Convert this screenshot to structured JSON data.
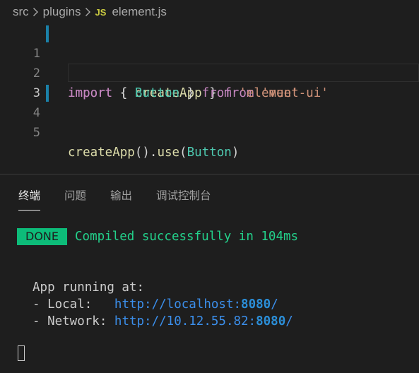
{
  "breadcrumb": {
    "folder1": "src",
    "folder2": "plugins",
    "file_icon": "JS",
    "file_name": "element.js"
  },
  "editor": {
    "lines": [
      {
        "number": "1",
        "tokens": {
          "t1": "import",
          "t2": " { ",
          "t3": "createApp",
          "t4": " } ",
          "t5": "from",
          "t6": " ",
          "t7": "'vue'"
        }
      },
      {
        "number": "2",
        "tokens": {
          "t1": "import",
          "t2": " { ",
          "t3": "Button",
          "t4": " } ",
          "t5": "from",
          "t6": " ",
          "t7": "'element-ui'"
        }
      },
      {
        "number": "3"
      },
      {
        "number": "4",
        "tokens": {
          "t1": "createApp",
          "t2": "().",
          "t3": "use",
          "t4": "(",
          "t5": "Button",
          "t6": ")"
        }
      },
      {
        "number": "5"
      }
    ],
    "active_line": "3"
  },
  "panel": {
    "tabs": [
      {
        "label": "终端",
        "active": true
      },
      {
        "label": "问题",
        "active": false
      },
      {
        "label": "输出",
        "active": false
      },
      {
        "label": "调试控制台",
        "active": false
      }
    ]
  },
  "terminal": {
    "done_badge": "DONE",
    "done_message": "Compiled successfully in 104ms",
    "app_running": "App running at:",
    "local_label": "- Local:   ",
    "local_url": "http://localhost:",
    "local_port": "8080",
    "local_slash": "/",
    "network_label": "- Network: ",
    "network_url": "http://10.12.55.82:",
    "network_port": "8080",
    "network_slash": "/"
  },
  "colors": {
    "background": "#1e1e1e",
    "keyword": "#c586c0",
    "string": "#ce9178",
    "function": "#dcdcaa",
    "variable": "#9cdcfe",
    "class": "#4ec9b0",
    "success_green": "#0dbc79",
    "link_blue": "#3b8eea",
    "git_modified_bar": "#1b81a8"
  }
}
